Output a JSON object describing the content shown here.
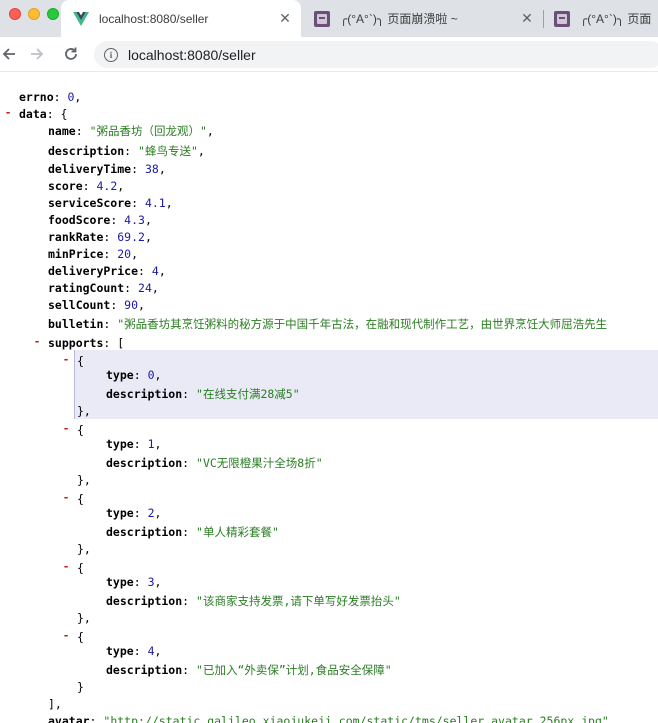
{
  "browser": {
    "tabs": [
      {
        "title": "localhost:8080/seller",
        "icon": "vue-logo-icon",
        "active": true
      },
      {
        "title": "╭(°A°`)╮ 页面崩溃啦 ~",
        "icon": "ghost-favicon-icon",
        "active": false
      },
      {
        "title": "╭(°A°`)╮ 页面",
        "icon": "ghost-favicon-icon",
        "active": false
      }
    ],
    "close_glyph": "✕",
    "url": "localhost:8080/seller"
  },
  "json": {
    "errno": {
      "key": "errno",
      "value": "0"
    },
    "data_key": "data",
    "name": {
      "key": "name",
      "value": "\"粥品香坊（回龙观）\""
    },
    "description": {
      "key": "description",
      "value": "\"蜂鸟专送\""
    },
    "deliveryTime": {
      "key": "deliveryTime",
      "value": "38"
    },
    "score": {
      "key": "score",
      "value": "4.2"
    },
    "serviceScore": {
      "key": "serviceScore",
      "value": "4.1"
    },
    "foodScore": {
      "key": "foodScore",
      "value": "4.3"
    },
    "rankRate": {
      "key": "rankRate",
      "value": "69.2"
    },
    "minPrice": {
      "key": "minPrice",
      "value": "20"
    },
    "deliveryPrice": {
      "key": "deliveryPrice",
      "value": "4"
    },
    "ratingCount": {
      "key": "ratingCount",
      "value": "24"
    },
    "sellCount": {
      "key": "sellCount",
      "value": "90"
    },
    "bulletin": {
      "key": "bulletin",
      "value": "\"粥品香坊其烹饪粥料的秘方源于中国千年古法，在融和现代制作工艺，由世界烹饪大师屈浩先生"
    },
    "supports_key": "supports",
    "supports": [
      {
        "type": "0",
        "description": "\"在线支付满28减5\""
      },
      {
        "type": "1",
        "description": "\"VC无限橙果汁全场8折\""
      },
      {
        "type": "2",
        "description": "\"单人精彩套餐\""
      },
      {
        "type": "3",
        "description": "\"该商家支持发票,请下单写好发票抬头\""
      },
      {
        "type": "4",
        "description": "\"已加入“外卖保”计划,食品安全保障\""
      }
    ],
    "item_keys": {
      "type": "type",
      "description": "description"
    },
    "avatar": {
      "key": "avatar",
      "value": "\"http://static.galileo.xiaojukeji.com/static/tms/seller_avatar_256px.jpg\""
    },
    "collapse_glyph": "-"
  }
}
